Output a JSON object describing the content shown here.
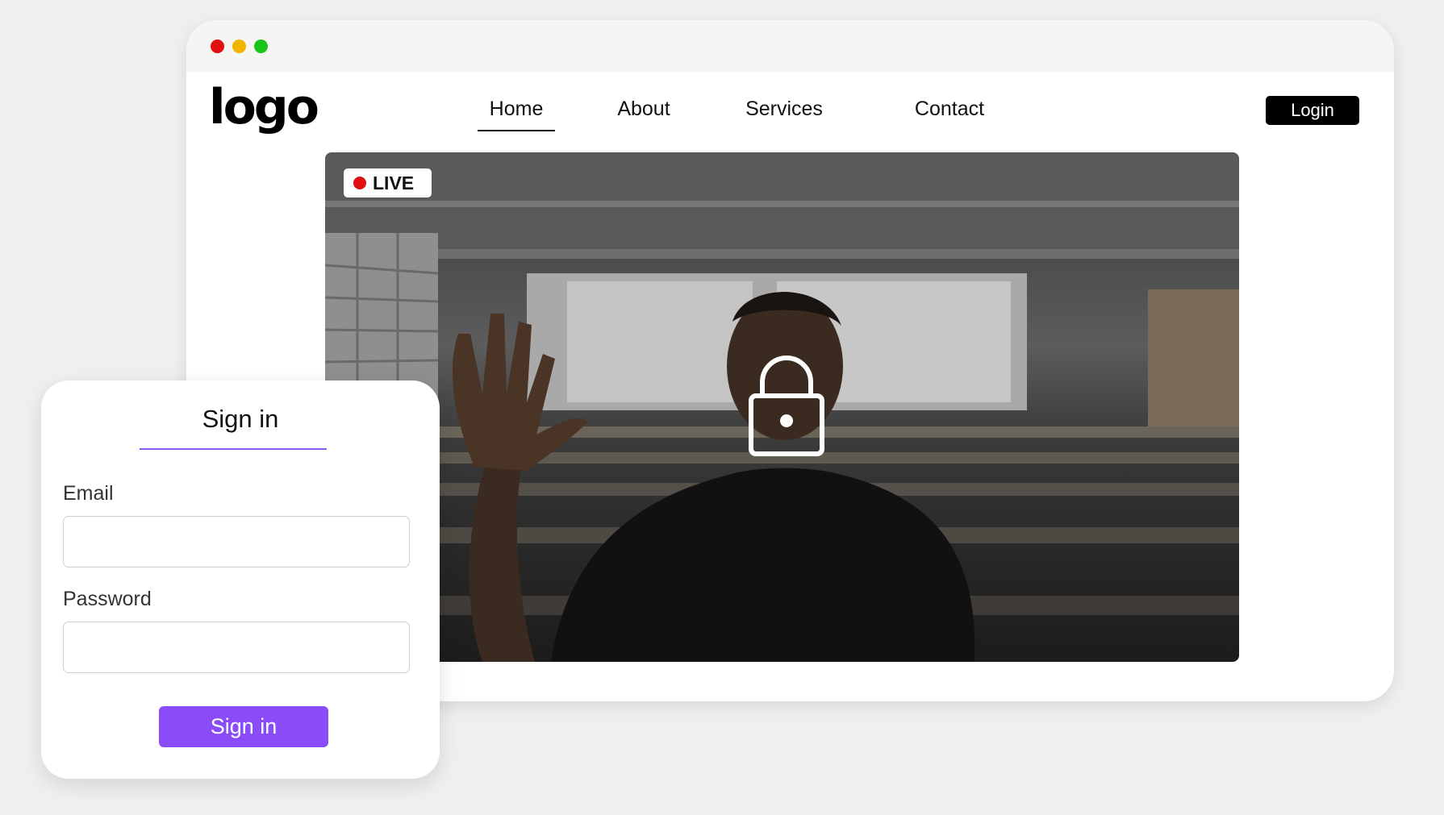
{
  "browser": {
    "window_controls": [
      "close",
      "minimize",
      "maximize"
    ],
    "colors": {
      "close": "#e01010",
      "minimize": "#f3b400",
      "maximize": "#18c418"
    }
  },
  "header": {
    "logo": "logo",
    "nav": [
      {
        "label": "Home",
        "active": true
      },
      {
        "label": "About",
        "active": false
      },
      {
        "label": "Services",
        "active": false
      },
      {
        "label": "Contact",
        "active": false
      }
    ],
    "login_label": "Login"
  },
  "video": {
    "live_label": "LIVE",
    "live_color": "#e01010",
    "overlay_icon": "lock-icon",
    "scene": "person waving in a lecture hall"
  },
  "signin": {
    "title": "Sign in",
    "email_label": "Email",
    "email_value": "",
    "password_label": "Password",
    "password_value": "",
    "submit_label": "Sign in",
    "accent_color": "#8a4cf8"
  }
}
